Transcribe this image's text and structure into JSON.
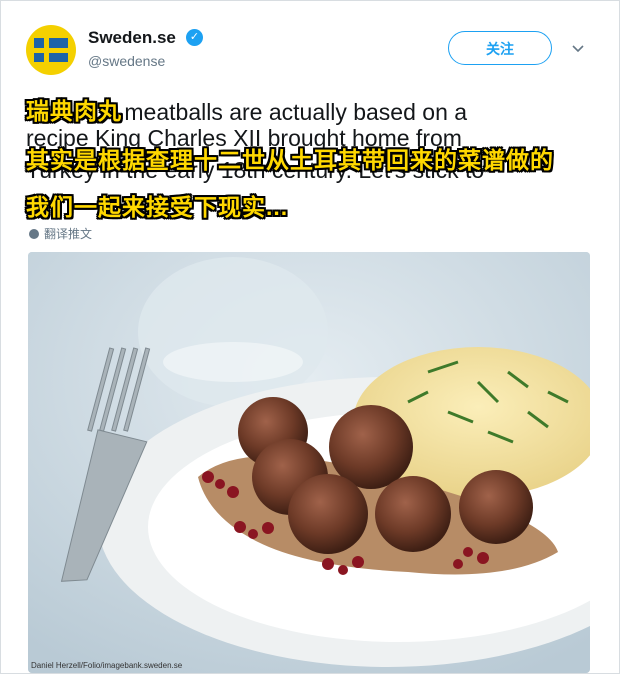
{
  "tweet": {
    "account_name": "Sweden.se",
    "handle": "@swedense",
    "follow_label": "关注",
    "text_lines": [
      " meatballs are actually based on a",
      "recipe King Charles XII brought home from",
      "Turkey in the early 18th century. Let's stick to"
    ],
    "overlay_lines": [
      "瑞典肉丸",
      "其实是根据查理十二世从土耳其带回来的菜谱做的",
      "我们一起来接受下现实..."
    ],
    "translate_label": "翻译推文",
    "photo_credit": "Daniel Herzell/Folio/imagebank.sweden.se"
  },
  "colors": {
    "accent": "#1da1f2",
    "overlay_text": "#ffd800",
    "flag_blue": "#1d63a8",
    "flag_yellow": "#f4d000"
  }
}
